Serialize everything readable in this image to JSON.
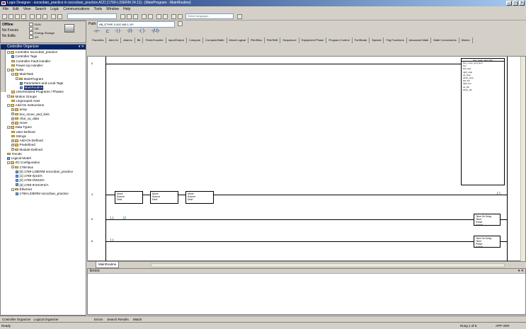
{
  "window": {
    "title": "Logix Designer - sococban_practice in sococban_practice.ACD [1769-L33ERM 24.11] - [MainProgram - MainRoutine]"
  },
  "menu": [
    "File",
    "Edit",
    "View",
    "Search",
    "Logic",
    "Communications",
    "Tools",
    "Window",
    "Help"
  ],
  "toolbar": {
    "language_placeholder": "Select language..."
  },
  "status": {
    "mode": "Offline",
    "forces": "No Forces",
    "edits": "No Edits",
    "indicators": [
      "RUN",
      "OK",
      "Energy Storage",
      "I/O"
    ]
  },
  "path": {
    "label": "Path:",
    "value": "AB_ETHIP-1\\192.168.1.10*"
  },
  "instruction_tabs": [
    "Favorites",
    "Add-On",
    "Alarms",
    "Bit",
    "Timer/Counter",
    "Input/Output",
    "Compare",
    "Compute/Math",
    "Move/Logical",
    "File/Misc",
    "File/Shift",
    "Sequencer",
    "Equipment Phase",
    "Program Control",
    "For/Break",
    "Special",
    "Trig Functions",
    "Advanced Math",
    "Math Conversions",
    "Motion"
  ],
  "organizer": {
    "title": "Controller Organizer",
    "tree": [
      {
        "label": "Controller sococban_practice",
        "depth": 0,
        "kind": "folder",
        "exp": "-"
      },
      {
        "label": "Controller Tags",
        "depth": 1,
        "kind": "doc"
      },
      {
        "label": "Controller Fault Handler",
        "depth": 1,
        "kind": "folder"
      },
      {
        "label": "Power-Up Handler",
        "depth": 1,
        "kind": "folder"
      },
      {
        "label": "Tasks",
        "depth": 0,
        "kind": "folder",
        "exp": "-"
      },
      {
        "label": "MainTask",
        "depth": 1,
        "kind": "folder",
        "exp": "-"
      },
      {
        "label": "MainProgram",
        "depth": 2,
        "kind": "folder",
        "exp": "-"
      },
      {
        "label": "Parameters and Local Tags",
        "depth": 3,
        "kind": "doc"
      },
      {
        "label": "MainRoutine",
        "depth": 3,
        "kind": "doc",
        "selected": true
      },
      {
        "label": "Unscheduled Programs / Phases",
        "depth": 1,
        "kind": "folder"
      },
      {
        "label": "Motion Groups",
        "depth": 0,
        "kind": "folder",
        "exp": "-"
      },
      {
        "label": "Ungrouped Axes",
        "depth": 1,
        "kind": "folder"
      },
      {
        "label": "Add-On Instructions",
        "depth": 0,
        "kind": "folder",
        "exp": "-"
      },
      {
        "label": "array",
        "depth": 1,
        "kind": "folder",
        "exp": "+"
      },
      {
        "label": "box_move_and_limit",
        "depth": 1,
        "kind": "folder",
        "exp": "+"
      },
      {
        "label": "char_xy_data",
        "depth": 1,
        "kind": "folder",
        "exp": "+"
      },
      {
        "label": "move",
        "depth": 1,
        "kind": "folder",
        "exp": "+"
      },
      {
        "label": "Data Types",
        "depth": 0,
        "kind": "folder",
        "exp": "-"
      },
      {
        "label": "User-Defined",
        "depth": 1,
        "kind": "folder"
      },
      {
        "label": "Strings",
        "depth": 1,
        "kind": "folder"
      },
      {
        "label": "Add-On-Defined",
        "depth": 1,
        "kind": "folder",
        "exp": "+"
      },
      {
        "label": "Predefined",
        "depth": 1,
        "kind": "folder",
        "exp": "+"
      },
      {
        "label": "Module-Defined",
        "depth": 1,
        "kind": "folder",
        "exp": "+"
      },
      {
        "label": "Trends",
        "depth": 0,
        "kind": "folder"
      },
      {
        "label": "Logical Model",
        "depth": 0,
        "kind": "doc"
      },
      {
        "label": "I/O Configuration",
        "depth": 0,
        "kind": "folder",
        "exp": "-"
      },
      {
        "label": "1769 Bus",
        "depth": 1,
        "kind": "folder",
        "exp": "-"
      },
      {
        "label": "[0] 1769-L33ERM sococban_practice",
        "depth": 2,
        "kind": "doc"
      },
      {
        "label": "[1] 1769-IQ16/A",
        "depth": 2,
        "kind": "doc"
      },
      {
        "label": "[2] 1769-OW16/A",
        "depth": 2,
        "kind": "doc"
      },
      {
        "label": "[3] 1769-IF4XOF2/A",
        "depth": 2,
        "kind": "doc"
      },
      {
        "label": "Ethernet",
        "depth": 1,
        "kind": "folder",
        "exp": "-"
      },
      {
        "label": "1769-L33ERM sococban_practice",
        "depth": 2,
        "kind": "doc"
      }
    ],
    "bottom_tabs": [
      "Controller Organizer",
      "Logical Organizer"
    ]
  },
  "ladder": {
    "rung_numbers": [
      "0",
      "4",
      "5",
      "6"
    ],
    "routine_tab": "MainRoutine",
    "aoi_title": "box_move_and_limit",
    "aoi_lines": [
      "box_move_and_limit",
      "box",
      "left_stop",
      "right_stop",
      "up_stop",
      "down_stop",
      "left_btn",
      "right_btn",
      "up_btn",
      "down_btn"
    ],
    "move_blocks": [
      {
        "label": "Move",
        "source": "Source",
        "dest": "Dest"
      },
      {
        "label": "Move",
        "source": "Source",
        "dest": "Dest"
      },
      {
        "label": "Move",
        "source": "Source",
        "dest": "Dest"
      }
    ],
    "timers": [
      {
        "title": "Timer On Delay",
        "timer": "Timer",
        "preset": "Preset",
        "accum": "Accum"
      },
      {
        "title": "Timer On Delay",
        "timer": "Timer",
        "preset": "Preset",
        "accum": "Accum"
      }
    ]
  },
  "errors": {
    "title": "Errors"
  },
  "output_tabs": [
    "Errors",
    "Search Results",
    "Watch"
  ],
  "statusbar": {
    "left": "Ready",
    "rung": "Rung 1 of 8",
    "app": "APP",
    "ver": "VER"
  }
}
